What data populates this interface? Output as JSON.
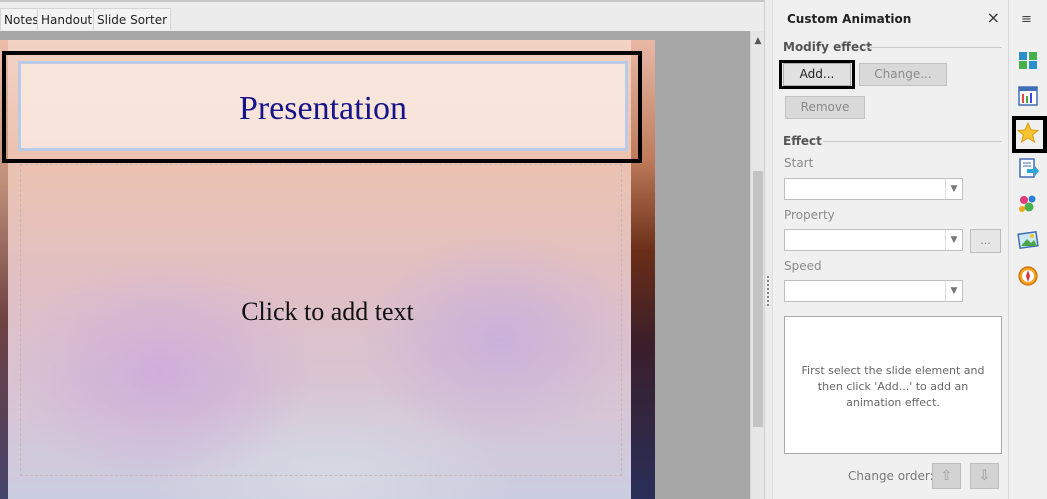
{
  "view_tabs": [
    "Notes",
    "Handout",
    "Slide Sorter"
  ],
  "slide": {
    "title": "Presentation",
    "body_placeholder": "Click to add text"
  },
  "panel": {
    "title": "Custom Animation",
    "close": "×",
    "modify_effect": {
      "label": "Modify effect",
      "add_button": "Add...",
      "change_button": "Change...",
      "remove_button": "Remove"
    },
    "effect": {
      "label": "Effect",
      "start_label": "Start",
      "start_value": "",
      "property_label": "Property",
      "property_value": "",
      "ellipsis": "...",
      "speed_label": "Speed",
      "speed_value": ""
    },
    "list_hint": "First select the slide element and then click 'Add...' to add an animation effect.",
    "change_order_label": "Change order:",
    "move_up": "⇧",
    "move_down": "⇩"
  },
  "sidebar": {
    "menu": "≡",
    "icons": [
      "slide-layout-icon",
      "master-slides-icon",
      "custom-animation-icon",
      "slide-transition-icon",
      "styles-icon",
      "gallery-icon",
      "navigator-icon"
    ],
    "active": "custom-animation-icon"
  },
  "colors": {
    "title_text": "#17148a",
    "panel_bg": "#f0f0f0",
    "workspace_bg": "#a7a7a7"
  }
}
